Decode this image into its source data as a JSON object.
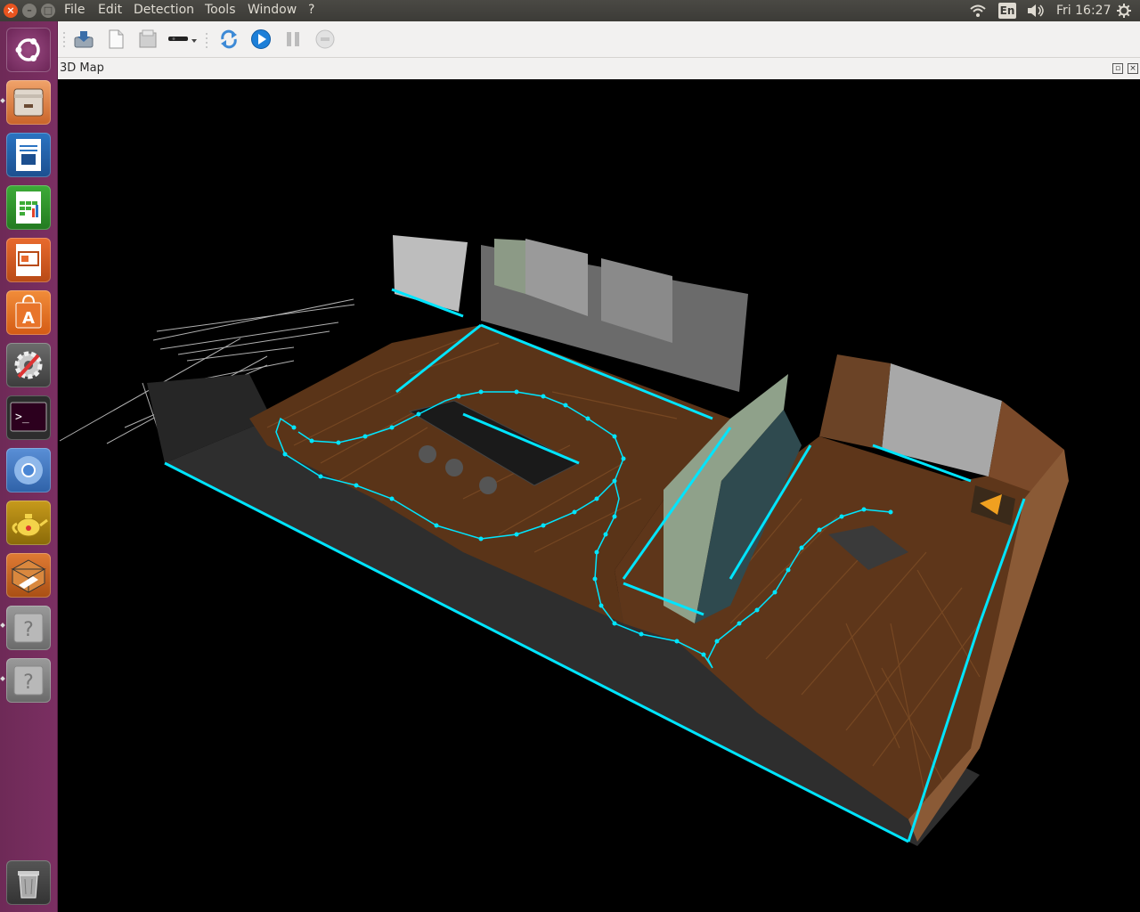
{
  "menubar": {
    "items": [
      {
        "label": "File"
      },
      {
        "label": "Edit"
      },
      {
        "label": "Detection"
      },
      {
        "label": "Tools"
      },
      {
        "label": "Window"
      },
      {
        "label": "?"
      }
    ]
  },
  "indicators": {
    "keyboard": "En",
    "clock": "Fri 16:27"
  },
  "launcher": {
    "items": [
      {
        "name": "ubuntu-dash-icon"
      },
      {
        "name": "files-icon"
      },
      {
        "name": "writer-icon"
      },
      {
        "name": "calc-icon"
      },
      {
        "name": "impress-icon"
      },
      {
        "name": "software-center-icon"
      },
      {
        "name": "system-settings-icon"
      },
      {
        "name": "terminal-icon"
      },
      {
        "name": "chromium-icon"
      },
      {
        "name": "teapot-icon"
      },
      {
        "name": "box-icon"
      },
      {
        "name": "unknown-app-icon"
      },
      {
        "name": "unknown-app-icon"
      },
      {
        "name": "trash-icon"
      }
    ]
  },
  "toolbar": {
    "buttons": [
      {
        "name": "open-database-icon"
      },
      {
        "name": "new-database-icon"
      },
      {
        "name": "close-database-icon"
      },
      {
        "name": "camera-source-icon"
      },
      {
        "name": "refresh-icon"
      },
      {
        "name": "start-icon"
      },
      {
        "name": "pause-icon"
      },
      {
        "name": "stop-icon"
      }
    ]
  },
  "dock": {
    "title": "3D Map"
  },
  "colors": {
    "trajectory": "#00e5ff",
    "floor": "#5a3418",
    "launcher": "#7b2f62"
  }
}
